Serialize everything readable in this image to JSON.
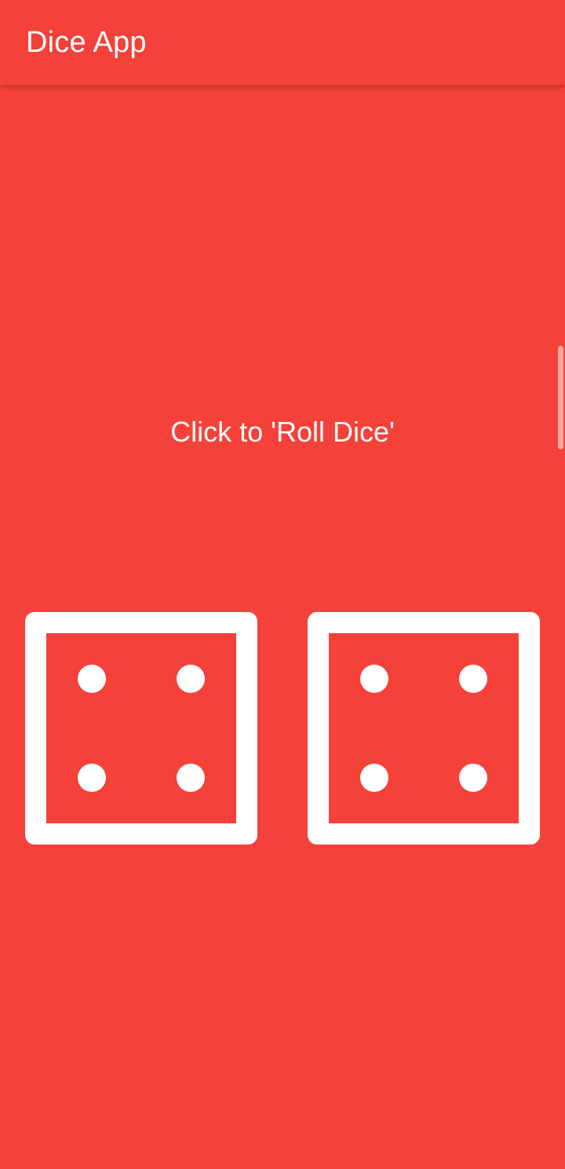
{
  "app": {
    "title": "Dice App",
    "background_color": "#F44139",
    "foreground_color": "#FFFFFF"
  },
  "main": {
    "prompt": "Click to 'Roll Dice'",
    "dice": [
      {
        "name": "left-die",
        "value": 4,
        "icon": "dice-four-icon"
      },
      {
        "name": "right-die",
        "value": 4,
        "icon": "dice-four-icon"
      }
    ]
  }
}
